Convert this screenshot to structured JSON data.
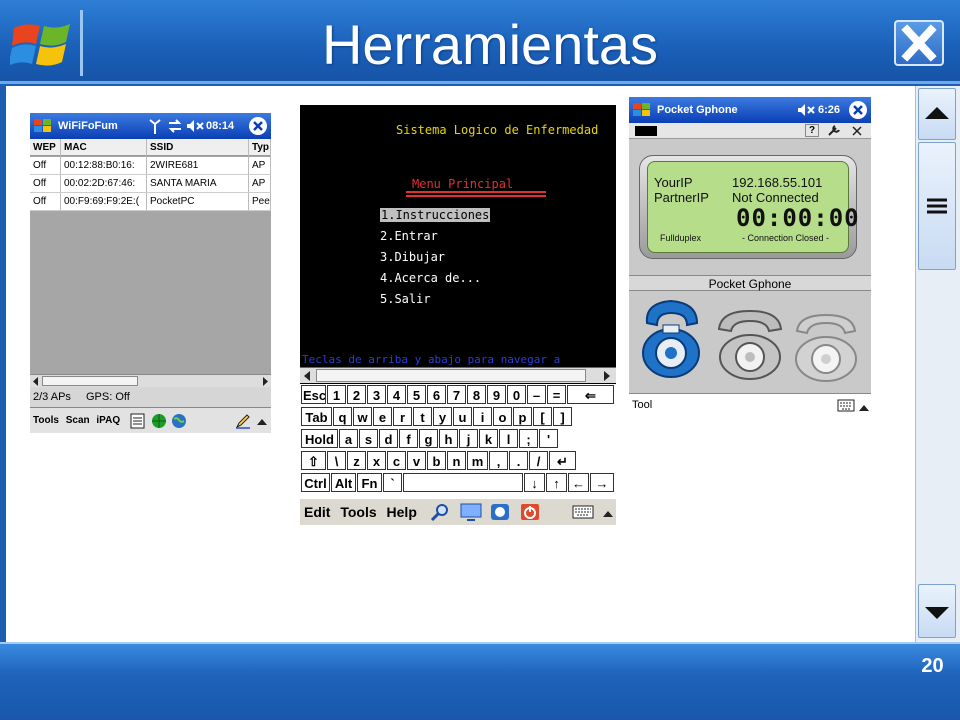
{
  "slide": {
    "title": "Herramientas",
    "page_number": "20"
  },
  "wifi": {
    "app_title": "WiFiFoFum",
    "time": "08:14",
    "columns": [
      "WEP",
      "MAC",
      "SSID",
      "Typ"
    ],
    "rows": [
      {
        "wep": "Off",
        "mac": "00:12:88:B0:16:",
        "ssid": "2WIRE681",
        "type": "AP"
      },
      {
        "wep": "Off",
        "mac": "00:02:2D:67:46:",
        "ssid": "SANTA  MARIA",
        "type": "AP"
      },
      {
        "wep": "Off",
        "mac": "00:F9:69:F9:2E:(",
        "ssid": "PocketPC",
        "type": "Pee"
      }
    ],
    "status_aps": "2/3 APs",
    "status_gps": "GPS: Off",
    "menu": {
      "tools": "Tools",
      "scan": "Scan",
      "ipaq": "iPAQ"
    }
  },
  "med": {
    "header": "Sistema Logico de Enfermedad",
    "menu_title": "Menu Principal",
    "items": [
      "1.Instrucciones",
      "2.Entrar",
      "3.Dibujar",
      "4.Acerca de...",
      "5.Salir"
    ],
    "hint": "Teclas de arriba y abajo para navegar a",
    "keys": {
      "row1": [
        "Esc",
        "1",
        "2",
        "3",
        "4",
        "5",
        "6",
        "7",
        "8",
        "9",
        "0",
        "–",
        "=",
        "⇐"
      ],
      "row2": [
        "Tab",
        "q",
        "w",
        "e",
        "r",
        "t",
        "y",
        "u",
        "i",
        "o",
        "p",
        "[",
        "]"
      ],
      "row3": [
        "Hold",
        "a",
        "s",
        "d",
        "f",
        "g",
        "h",
        "j",
        "k",
        "l",
        ";",
        "'"
      ],
      "row4": [
        "⇧",
        "\\",
        "z",
        "x",
        "c",
        "v",
        "b",
        "n",
        "m",
        ",",
        ".",
        "/",
        "↵"
      ],
      "row5": [
        "Ctrl",
        "Alt",
        "Fn",
        "`",
        "↓",
        "↑",
        "←",
        "→"
      ]
    },
    "menu": {
      "edit": "Edit",
      "tools": "Tools",
      "help": "Help"
    }
  },
  "gphone": {
    "app_title": "Pocket Gphone",
    "time": "6:26",
    "your_ip_label": "YourIP",
    "your_ip": "192.168.55.101",
    "partner_ip_label": "PartnerIP",
    "partner_ip": "Not Connected",
    "timer": "00:00:00",
    "duplex": "Fullduplex",
    "conn_status": "- Connection Closed -",
    "panel_label": "Pocket Gphone",
    "menu_tool": "Tool"
  },
  "colors": {
    "brand_blue": "#1c5fb2",
    "terminal_yellow": "#e6d600",
    "terminal_red": "#e03030",
    "lcd_green": "#b6dd8a"
  }
}
